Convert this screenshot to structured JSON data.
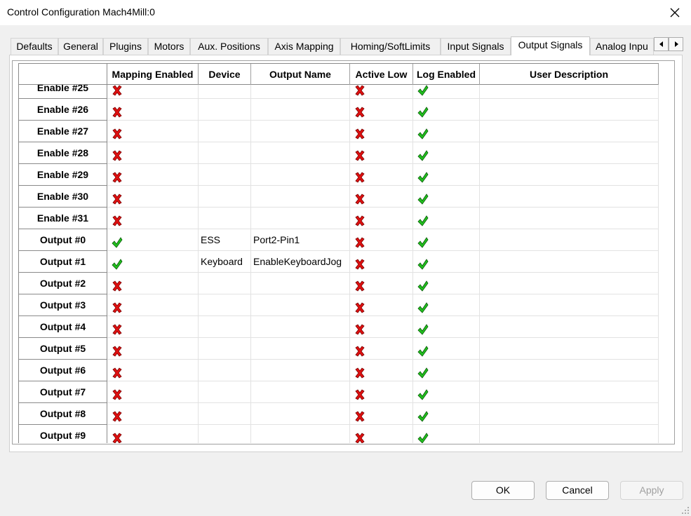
{
  "window": {
    "title": "Control Configuration Mach4Mill:0"
  },
  "tabs": [
    {
      "label": "Defaults"
    },
    {
      "label": "General"
    },
    {
      "label": "Plugins"
    },
    {
      "label": "Motors"
    },
    {
      "label": "Aux. Positions"
    },
    {
      "label": "Axis Mapping"
    },
    {
      "label": "Homing/SoftLimits"
    },
    {
      "label": "Input Signals"
    },
    {
      "label": "Output Signals",
      "active": true
    },
    {
      "label": "Analog Inpu"
    }
  ],
  "grid": {
    "columns": [
      "",
      "Mapping Enabled",
      "Device",
      "Output Name",
      "Active Low",
      "Log Enabled",
      "User Description"
    ],
    "rows": [
      {
        "name": "Enable #25",
        "mapping": false,
        "device": "",
        "output": "",
        "active_low": false,
        "log": true,
        "desc": ""
      },
      {
        "name": "Enable #26",
        "mapping": false,
        "device": "",
        "output": "",
        "active_low": false,
        "log": true,
        "desc": ""
      },
      {
        "name": "Enable #27",
        "mapping": false,
        "device": "",
        "output": "",
        "active_low": false,
        "log": true,
        "desc": ""
      },
      {
        "name": "Enable #28",
        "mapping": false,
        "device": "",
        "output": "",
        "active_low": false,
        "log": true,
        "desc": ""
      },
      {
        "name": "Enable #29",
        "mapping": false,
        "device": "",
        "output": "",
        "active_low": false,
        "log": true,
        "desc": ""
      },
      {
        "name": "Enable #30",
        "mapping": false,
        "device": "",
        "output": "",
        "active_low": false,
        "log": true,
        "desc": ""
      },
      {
        "name": "Enable #31",
        "mapping": false,
        "device": "",
        "output": "",
        "active_low": false,
        "log": true,
        "desc": ""
      },
      {
        "name": "Output #0",
        "mapping": true,
        "device": "ESS",
        "output": "Port2-Pin1",
        "active_low": false,
        "log": true,
        "desc": ""
      },
      {
        "name": "Output #1",
        "mapping": true,
        "device": "Keyboard",
        "output": "EnableKeyboardJog",
        "active_low": false,
        "log": true,
        "desc": ""
      },
      {
        "name": "Output #2",
        "mapping": false,
        "device": "",
        "output": "",
        "active_low": false,
        "log": true,
        "desc": ""
      },
      {
        "name": "Output #3",
        "mapping": false,
        "device": "",
        "output": "",
        "active_low": false,
        "log": true,
        "desc": ""
      },
      {
        "name": "Output #4",
        "mapping": false,
        "device": "",
        "output": "",
        "active_low": false,
        "log": true,
        "desc": ""
      },
      {
        "name": "Output #5",
        "mapping": false,
        "device": "",
        "output": "",
        "active_low": false,
        "log": true,
        "desc": ""
      },
      {
        "name": "Output #6",
        "mapping": false,
        "device": "",
        "output": "",
        "active_low": false,
        "log": true,
        "desc": ""
      },
      {
        "name": "Output #7",
        "mapping": false,
        "device": "",
        "output": "",
        "active_low": false,
        "log": true,
        "desc": ""
      },
      {
        "name": "Output #8",
        "mapping": false,
        "device": "",
        "output": "",
        "active_low": false,
        "log": true,
        "desc": ""
      },
      {
        "name": "Output #9",
        "mapping": false,
        "device": "",
        "output": "",
        "active_low": false,
        "log": true,
        "desc": ""
      }
    ]
  },
  "buttons": {
    "ok": "OK",
    "cancel": "Cancel",
    "apply": "Apply"
  },
  "icons": {
    "enabled": "green-check-icon",
    "disabled": "red-x-icon"
  },
  "colors": {
    "check_green": "#22c01e",
    "x_red": "#e01010"
  }
}
